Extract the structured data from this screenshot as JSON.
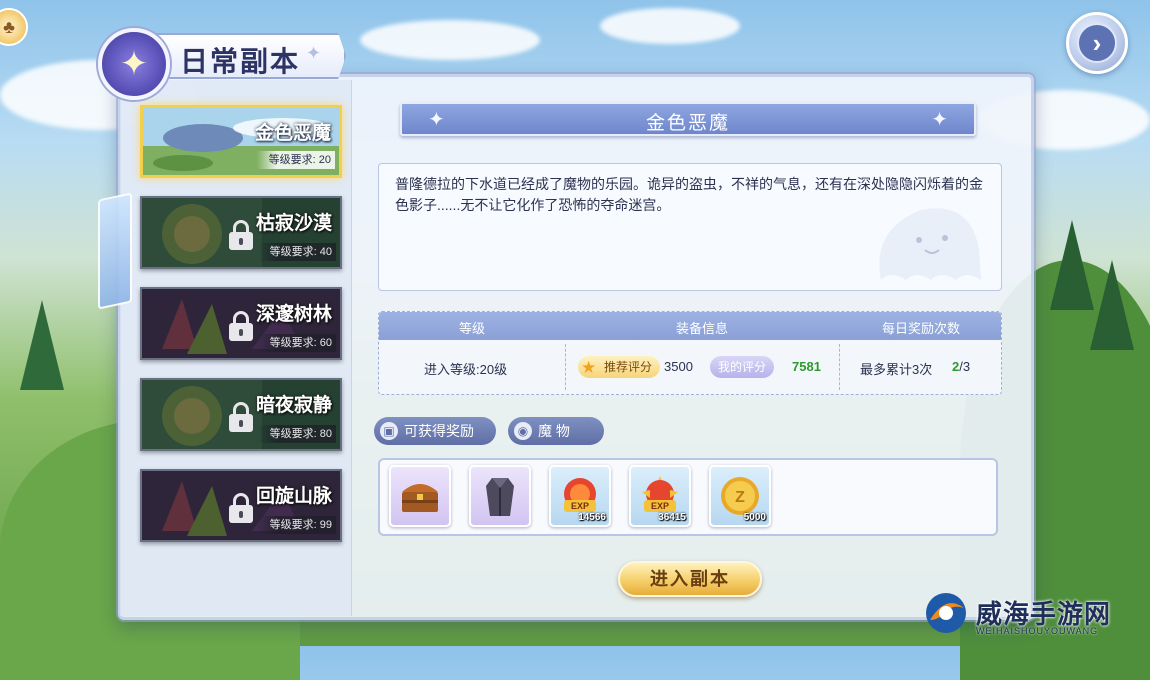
{
  "header": {
    "title": "日常副本"
  },
  "dungeons": [
    {
      "name": "金色恶魔",
      "req": "等级要求: 20",
      "locked": false
    },
    {
      "name": "枯寂沙漠",
      "req": "等级要求: 40",
      "locked": true
    },
    {
      "name": "深邃树林",
      "req": "等级要求: 60",
      "locked": true
    },
    {
      "name": "暗夜寂静",
      "req": "等级要求: 80",
      "locked": true
    },
    {
      "name": "回旋山脉",
      "req": "等级要求: 99",
      "locked": true
    }
  ],
  "detail": {
    "title": "金色恶魔",
    "description": "普隆德拉的下水道已经成了魔物的乐园。诡异的盗虫，不祥的气息，还有在深处隐隐闪烁着的金色影子......无不让它化作了恐怖的夺命迷宫。"
  },
  "info": {
    "headers": [
      "等级",
      "装备信息",
      "每日奖励次数"
    ],
    "entry_level": "进入等级:20级",
    "recommended_label": "推荐评分",
    "recommended_value": "3500",
    "my_score_label": "我的评分",
    "my_score_value": "7581",
    "max_label": "最多累计3次",
    "count_current": "2",
    "count_total": "/3"
  },
  "tabs": {
    "rewards": "可获得奖励",
    "monsters": "魔 物"
  },
  "rewards": [
    {
      "icon": "treasure-chest-icon",
      "count": ""
    },
    {
      "icon": "coat-icon",
      "count": ""
    },
    {
      "icon": "exp-badge-icon",
      "count": "14566"
    },
    {
      "icon": "job-exp-badge-icon",
      "count": "36415"
    },
    {
      "icon": "zeny-coin-icon",
      "count": "5000"
    }
  ],
  "enter_button": "进入副本",
  "watermark": {
    "name": "威海手游网",
    "url": "WEIHAISHOUYOUWANG"
  },
  "colors": {
    "accent": "#6f86cc",
    "gold": "#f5cf6a",
    "selected_border": "#f3cf4e",
    "score_green": "#2e9a2e"
  }
}
